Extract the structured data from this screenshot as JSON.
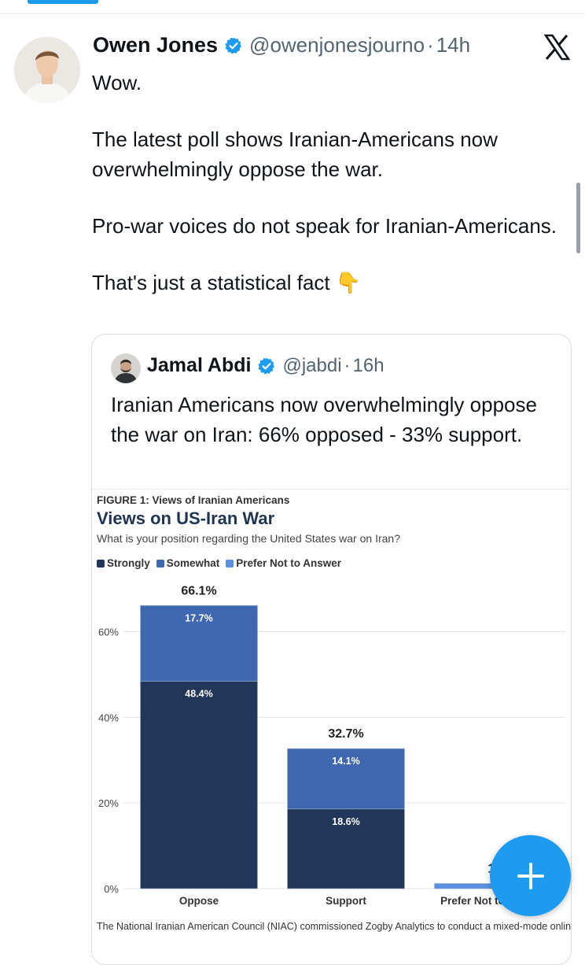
{
  "tweet": {
    "author_name": "Owen Jones",
    "handle": "@owenjonesjourno",
    "separator": "·",
    "time": "14h",
    "paragraphs": [
      "Wow.",
      "The latest poll shows Iranian-Americans now overwhelmingly oppose the war.",
      "Pro-war voices do not speak for Iranian-Americans.",
      "That's just a statistical fact 👇"
    ]
  },
  "quote": {
    "author_name": "Jamal Abdi",
    "handle": "@jabdi",
    "separator": "·",
    "time": "16h",
    "text": "Iranian Americans now overwhelmingly oppose the war on Iran: 66% opposed - 33% support."
  },
  "figure": {
    "label": "FIGURE 1: Views of Iranian Americans",
    "title": "Views on US-Iran War",
    "subtitle": "What is your position regarding the United States war on Iran?",
    "note": "The National Iranian American Council (NIAC) commissioned Zogby Analytics to conduct a mixed-mode online and"
  },
  "chart_data": {
    "type": "bar",
    "stacked": true,
    "title": "Views on US-Iran War",
    "categories": [
      "Oppose",
      "Support",
      "Prefer Not to Answer"
    ],
    "series": [
      {
        "name": "Strongly",
        "color": "#22365a",
        "values": [
          48.4,
          18.6,
          0
        ]
      },
      {
        "name": "Somewhat",
        "color": "#4068b0",
        "values": [
          17.7,
          14.1,
          0
        ]
      },
      {
        "name": "Prefer Not to Answer",
        "color": "#5b8fe0",
        "values": [
          0,
          0,
          1.2
        ]
      }
    ],
    "segment_labels": [
      [
        "48.4%",
        "17.7%"
      ],
      [
        "18.6%",
        "14.1%"
      ],
      []
    ],
    "totals": [
      "66.1%",
      "32.7%",
      "1."
    ],
    "yticks": [
      "0%",
      "20%",
      "40%",
      "60%"
    ],
    "ylim": [
      0,
      70
    ],
    "grid": true,
    "legend": "top-left"
  },
  "colors": {
    "accent": "#1d9bf0",
    "verified": "#1d9bf0"
  },
  "icons": {
    "verified": "verified-badge-icon",
    "x": "x-logo-icon",
    "fab": "plus-icon"
  }
}
